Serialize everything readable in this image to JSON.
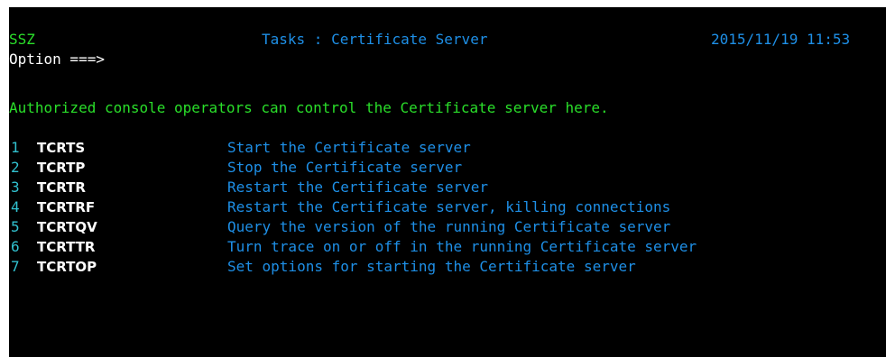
{
  "header": {
    "system": "SSZ",
    "title": "Tasks : Certificate Server",
    "datetime": "2015/11/19 11:53"
  },
  "command": {
    "label": "Option ===>",
    "value": ""
  },
  "info": "Authorized console operators can control the Certificate server here.",
  "options": [
    {
      "num": "1",
      "cmd": "TCRTS",
      "desc": "Start the Certificate server"
    },
    {
      "num": "2",
      "cmd": "TCRTP",
      "desc": "Stop the Certificate server"
    },
    {
      "num": "3",
      "cmd": "TCRTR",
      "desc": "Restart the Certificate server"
    },
    {
      "num": "4",
      "cmd": "TCRTRF",
      "desc": "Restart the Certificate server, killing connections"
    },
    {
      "num": "5",
      "cmd": "TCRTQV",
      "desc": "Query the version of the running Certificate server"
    },
    {
      "num": "6",
      "cmd": "TCRTTR",
      "desc": "Turn trace on or off in the running Certificate server"
    },
    {
      "num": "7",
      "cmd": "TCRTOP",
      "desc": "Set options for starting the Certificate server"
    }
  ],
  "colors": {
    "background": "#000000",
    "header": "#2adf2a",
    "title": "#1e8fe6",
    "option_number": "#31c1cf",
    "command": "#ffffff",
    "description": "#1e8fe6"
  }
}
